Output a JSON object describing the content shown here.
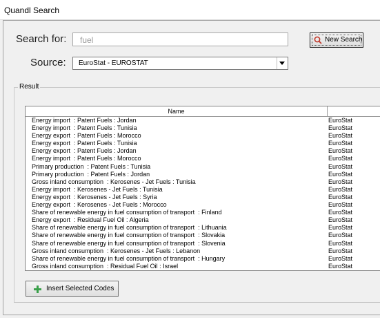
{
  "window": {
    "title": "Quandl Search"
  },
  "search": {
    "label": "Search for:",
    "value": "fuel",
    "button_label": "New Search",
    "button_icon": "search-icon"
  },
  "source": {
    "label": "Source:",
    "selected": "EuroStat - EUROSTAT"
  },
  "result": {
    "group_label": "Result",
    "columns": [
      "Name",
      ""
    ],
    "rows": [
      {
        "name": "Energy import  : Patent Fuels : Jordan",
        "source": "EuroStat"
      },
      {
        "name": "Energy import  : Patent Fuels : Tunisia",
        "source": "EuroStat"
      },
      {
        "name": "Energy export  : Patent Fuels : Morocco",
        "source": "EuroStat"
      },
      {
        "name": "Energy export  : Patent Fuels : Tunisia",
        "source": "EuroStat"
      },
      {
        "name": "Energy export  : Patent Fuels : Jordan",
        "source": "EuroStat"
      },
      {
        "name": "Energy import  : Patent Fuels : Morocco",
        "source": "EuroStat"
      },
      {
        "name": "Primary production  : Patent Fuels : Tunisia",
        "source": "EuroStat"
      },
      {
        "name": "Primary production  : Patent Fuels : Jordan",
        "source": "EuroStat"
      },
      {
        "name": "Gross inland consumption  : Kerosenes - Jet Fuels : Tunisia",
        "source": "EuroStat"
      },
      {
        "name": "Energy import  : Kerosenes - Jet Fuels : Tunisia",
        "source": "EuroStat"
      },
      {
        "name": "Energy export  : Kerosenes - Jet Fuels : Syria",
        "source": "EuroStat"
      },
      {
        "name": "Energy export  : Kerosenes - Jet Fuels : Morocco",
        "source": "EuroStat"
      },
      {
        "name": "Share of renewable energy in fuel consumption of transport  : Finland",
        "source": "EuroStat"
      },
      {
        "name": "Energy export  : Residual Fuel Oil : Algeria",
        "source": "EuroStat"
      },
      {
        "name": "Share of renewable energy in fuel consumption of transport  : Lithuania",
        "source": "EuroStat"
      },
      {
        "name": "Share of renewable energy in fuel consumption of transport  : Slovakia",
        "source": "EuroStat"
      },
      {
        "name": "Share of renewable energy in fuel consumption of transport  : Slovenia",
        "source": "EuroStat"
      },
      {
        "name": "Gross inland consumption  : Kerosenes - Jet Fuels : Lebanon",
        "source": "EuroStat"
      },
      {
        "name": "Share of renewable energy in fuel consumption of transport  : Hungary",
        "source": "EuroStat"
      },
      {
        "name": "Gross inland consumption  : Residual Fuel Oil : Israel",
        "source": "EuroStat"
      }
    ]
  },
  "actions": {
    "insert_label": "Insert Selected Codes",
    "insert_icon": "plus-icon"
  },
  "colors": {
    "accent_red": "#c0392b",
    "plus_green": "#3aa04a"
  }
}
